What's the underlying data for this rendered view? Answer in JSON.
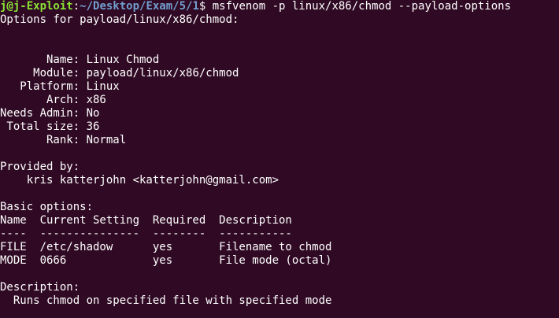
{
  "prompt": {
    "user_host": "j@j-Exploit",
    "colon": ":",
    "path": "~/Desktop/Exam/5/1",
    "dollar": "$ ",
    "command": "msfvenom -p linux/x86/chmod --payload-options"
  },
  "output": {
    "header": "Options for payload/linux/x86/chmod:",
    "info_rows": [
      {
        "key": "       Name: ",
        "value": "Linux Chmod"
      },
      {
        "key": "     Module: ",
        "value": "payload/linux/x86/chmod"
      },
      {
        "key": "   Platform: ",
        "value": "Linux"
      },
      {
        "key": "       Arch: ",
        "value": "x86"
      },
      {
        "key": "Needs Admin: ",
        "value": "No"
      },
      {
        "key": " Total size: ",
        "value": "36"
      },
      {
        "key": "       Rank: ",
        "value": "Normal"
      }
    ],
    "provided_by_label": "Provided by:",
    "author": "    kris katterjohn <katterjohn@gmail.com>",
    "basic_options_label": "Basic options:",
    "table_header": "Name  Current Setting  Required  Description",
    "table_rule": "----  ---------------  --------  -----------",
    "table_rows": [
      "FILE  /etc/shadow      yes       Filename to chmod",
      "MODE  0666             yes       File mode (octal)"
    ],
    "description_label": "Description:",
    "description_text": "  Runs chmod on specified file with specified mode"
  }
}
